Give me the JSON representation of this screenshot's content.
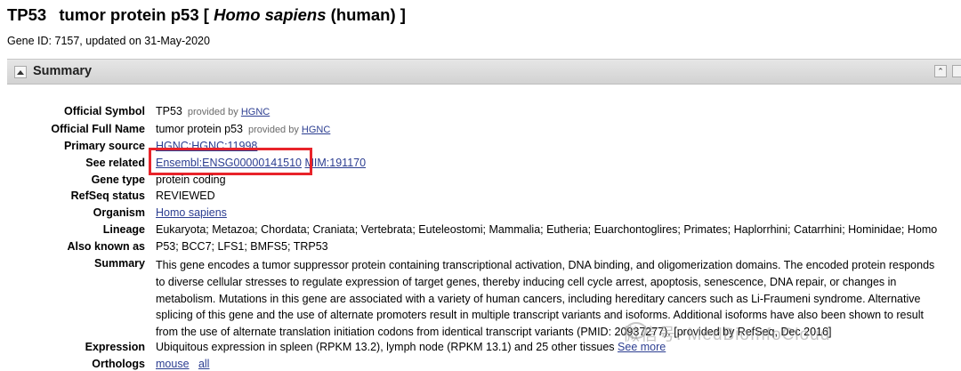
{
  "header": {
    "symbol": "TP53",
    "name": "tumor protein p53",
    "species_open": "[",
    "species_italic": "Homo sapiens",
    "species_common": "(human) ]",
    "gene_id_line": "Gene ID: 7157, updated on 31-May-2020"
  },
  "summary_section": {
    "title": "Summary",
    "collapse_icon": "collapse-all-icon"
  },
  "fields": {
    "official_symbol": {
      "label": "Official Symbol",
      "value": "TP53",
      "provided_by": "provided by",
      "provider": "HGNC"
    },
    "official_full_name": {
      "label": "Official Full Name",
      "value": "tumor protein p53",
      "provided_by": "provided by",
      "provider": "HGNC"
    },
    "primary_source": {
      "label": "Primary source",
      "value": "HGNC:HGNC:11998"
    },
    "see_related": {
      "label": "See related",
      "links": [
        "Ensembl:ENSG00000141510",
        "MIM:191170"
      ]
    },
    "gene_type": {
      "label": "Gene type",
      "value": "protein coding"
    },
    "refseq_status": {
      "label": "RefSeq status",
      "value": "REVIEWED"
    },
    "organism": {
      "label": "Organism",
      "value": "Homo sapiens"
    },
    "lineage": {
      "label": "Lineage",
      "value": "Eukaryota; Metazoa; Chordata; Craniata; Vertebrata; Euteleostomi; Mammalia; Eutheria; Euarchontoglires; Primates; Haplorrhini; Catarrhini; Hominidae; Homo"
    },
    "also_known_as": {
      "label": "Also known as",
      "value": "P53; BCC7; LFS1; BMFS5; TRP53"
    },
    "summary": {
      "label": "Summary",
      "lines": [
        "This gene encodes a tumor suppressor protein containing transcriptional activation, DNA binding, and oligomerization domains. The encoded protein responds",
        "to diverse cellular stresses to regulate expression of target genes, thereby inducing cell cycle arrest, apoptosis, senescence, DNA repair, or changes in",
        "metabolism. Mutations in this gene are associated with a variety of human cancers, including hereditary cancers such as Li-Fraumeni syndrome. Alternative",
        "splicing of this gene and the use of alternate promoters result in multiple transcript variants and isoforms. Additional isoforms have also been shown to result",
        "from the use of alternate translation initiation codons from identical transcript variants (PMID: 20937277). [provided by RefSeq, Dec 2016]"
      ]
    },
    "expression": {
      "label": "Expression",
      "value": "Ubiquitous expression in spleen (RPKM 13.2), lymph node (RPKM 13.1) and 25 other tissues",
      "link": "See more"
    },
    "orthologs": {
      "label": "Orthologs",
      "links": [
        "mouse",
        "all"
      ]
    }
  },
  "watermark": {
    "text": "微信号: MedBioInfoCloud"
  },
  "colors": {
    "highlight": "#e8232a",
    "link": "#2c3e91",
    "section_bar": "#dcdcdc"
  }
}
